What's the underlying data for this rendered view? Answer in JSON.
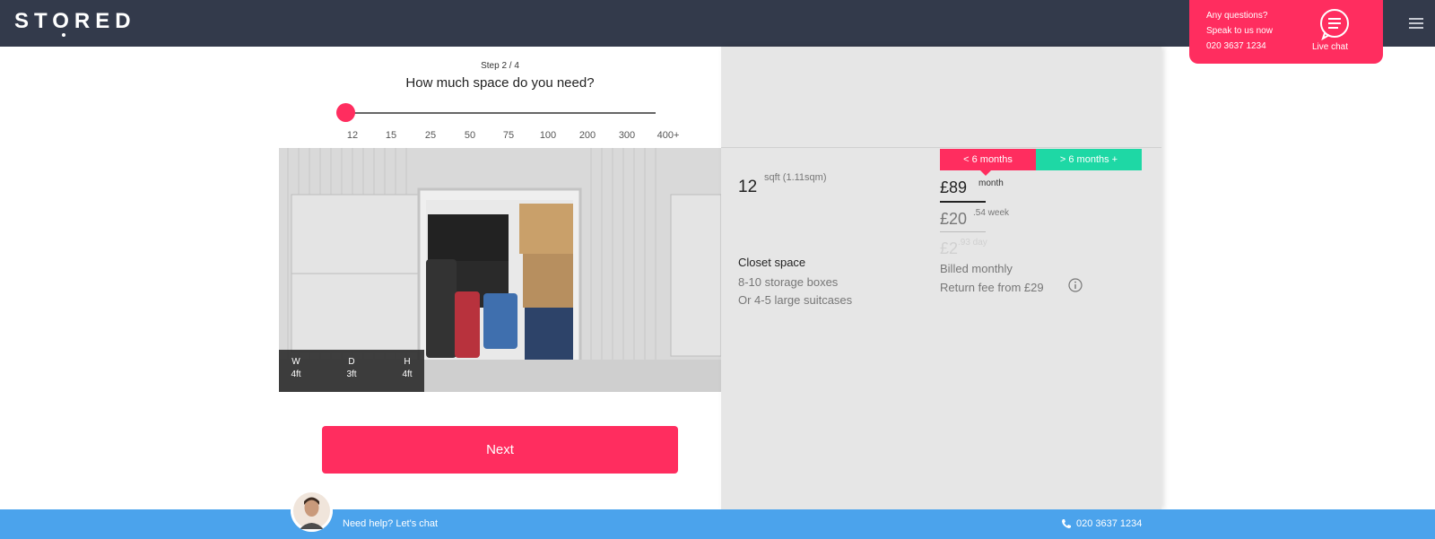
{
  "header": {
    "logo_text": "STORED",
    "contact_line1": "Any questions?",
    "contact_line2": "Speak to us now",
    "contact_phone": "020 3637 1234",
    "live_chat_label": "Live chat"
  },
  "wizard": {
    "step_label": "Step 2 / 4",
    "question": "How much space do you need?",
    "slider_value": "12",
    "ticks": [
      "12",
      "15",
      "25",
      "50",
      "75",
      "100",
      "200",
      "300",
      "400+"
    ],
    "dimensions": {
      "w_label": "W",
      "w_value": "4ft",
      "d_label": "D",
      "d_value": "3ft",
      "h_label": "H",
      "h_value": "4ft"
    },
    "next_label": "Next"
  },
  "pricing": {
    "tab_short": "< 6 months",
    "tab_long": "> 6 months +",
    "size_number": "12",
    "size_unit": "sqft (1.11sqm)",
    "month_price": "£89",
    "month_label": "month",
    "week_price": "£20",
    "week_label": ".54 week",
    "day_price": "£2",
    "day_label": ".93 day",
    "size_name": "Closet space",
    "size_desc1": "8-10 storage boxes",
    "size_desc2": "Or 4-5 large suitcases",
    "billed": "Billed monthly",
    "return_fee": "Return fee from £29"
  },
  "footer": {
    "help_text": "Need help? Let's chat",
    "phone": "020 3637 1234"
  },
  "colors": {
    "accent": "#ff2d5f",
    "teal": "#1ed8a5",
    "header_bg": "#333a4b",
    "footer_bg": "#4ba3ec"
  }
}
